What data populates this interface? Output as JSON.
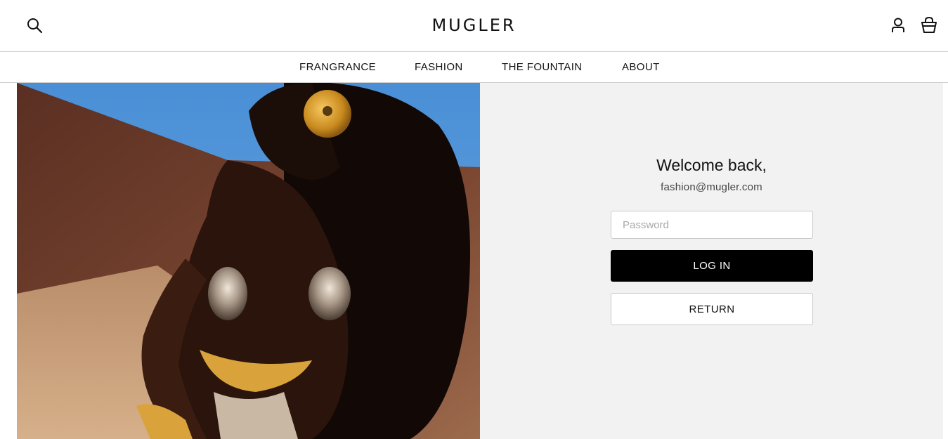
{
  "header": {
    "logo": "MUGLER",
    "icons": {
      "search": "search-icon",
      "account": "account-icon",
      "cart": "shopping-bag-icon"
    }
  },
  "nav": {
    "items": [
      {
        "label": "FRANGRANCE"
      },
      {
        "label": "FASHION"
      },
      {
        "label": "THE FOUNTAIN"
      },
      {
        "label": "ABOUT"
      }
    ]
  },
  "login": {
    "title": "Welcome back,",
    "email": "fashion@mugler.com",
    "password_placeholder": "Password",
    "password_value": "",
    "login_label": "LOG IN",
    "return_label": "RETURN"
  },
  "colors": {
    "panel_bg": "#f2f2f2",
    "primary_button": "#000000",
    "border": "#cfcfcf"
  }
}
